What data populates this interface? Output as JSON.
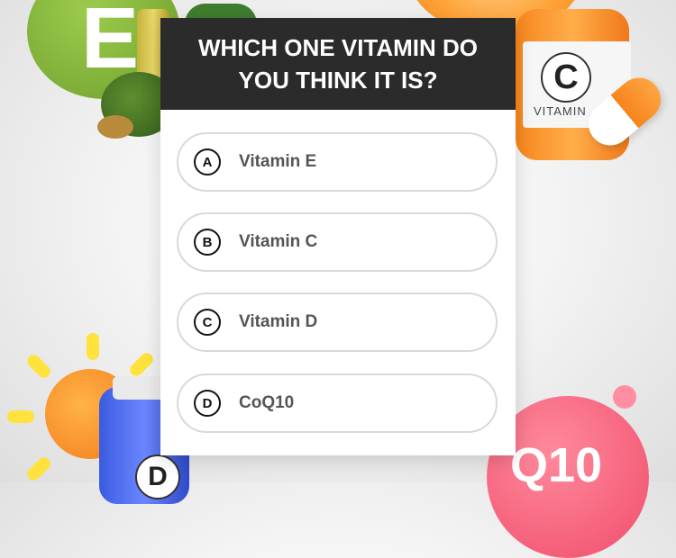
{
  "quiz": {
    "title": "WHICH ONE VITAMIN DO YOU THINK IT IS?",
    "options": [
      {
        "letter": "A",
        "label": "Vitamin E"
      },
      {
        "letter": "B",
        "label": "Vitamin C"
      },
      {
        "letter": "C",
        "label": "Vitamin D"
      },
      {
        "letter": "D",
        "label": "CoQ10"
      }
    ]
  },
  "decorations": {
    "vitamin_e_letter": "E",
    "vitamin_c_letter": "C",
    "vitamin_c_word": "VITAMIN",
    "vitamin_d_letter": "D",
    "q10_text": "Q10"
  },
  "colors": {
    "header_bg": "#2b2b2b",
    "card_bg": "#ffffff",
    "option_text": "#555555",
    "vitamin_e_green": "#8dbf45",
    "vitamin_c_orange": "#f7851c",
    "vitamin_d_blue": "#3b5be0",
    "q10_pink": "#f04d6b"
  }
}
